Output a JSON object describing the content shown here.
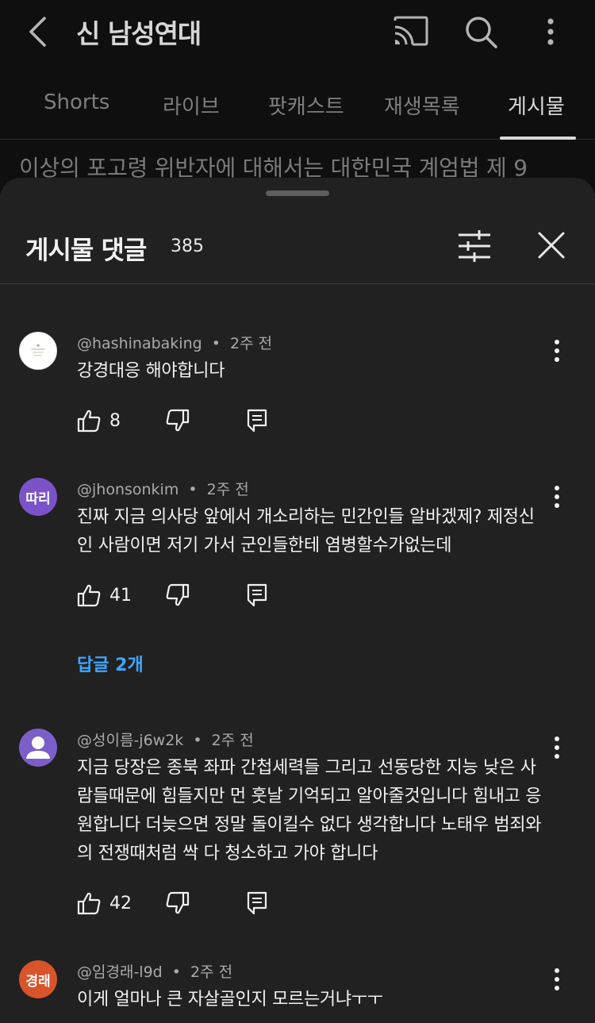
{
  "header": {
    "title": "신 남성연대",
    "icons": [
      "back-icon",
      "cast-icon",
      "search-icon",
      "more-icon"
    ]
  },
  "tabs": [
    {
      "label": "Shorts"
    },
    {
      "label": "라이브"
    },
    {
      "label": "팟캐스트"
    },
    {
      "label": "재생목록"
    },
    {
      "label": "게시물",
      "active": true
    }
  ],
  "post_preview": "이상의 포고령 위반자에 대해서는 대한민국 계엄법 제 9",
  "sheet": {
    "title": "게시물 댓글",
    "count": "385"
  },
  "comments": [
    {
      "author": "@hashinabaking",
      "time": "2주 전",
      "text": "강경대응 해야합니다",
      "likes": "8",
      "avatar_text": "",
      "avatar_color": "#ffffff"
    },
    {
      "author": "@jhonsonkim",
      "time": "2주 전",
      "text": "진짜 지금 의사당 앞에서 개소리하는 민간인들 알바겠제? 제정신인 사람이면 저기 가서 군인들한테 염병할수가없는데",
      "likes": "41",
      "avatar_text": "따리",
      "avatar_color": "#7a53c9",
      "replies": "답글 2개"
    },
    {
      "author": "@성이름-j6w2k",
      "time": "2주 전",
      "text": "지금 당장은 종북 좌파 간첩세력들 그리고 선동당한 지능 낮은 사람들때문에 힘들지만 먼 훗날 기억되고 알아줄것입니다 힘내고 응원합니다 더늦으면 정말 돌이킬수 없다 생각합니다 노태우 범죄와의 전쟁때처럼 싹 다 청소하고 가야 합니다",
      "likes": "42",
      "avatar_text": "",
      "avatar_color": "#7b5fc8"
    },
    {
      "author": "@임경래-l9d",
      "time": "2주 전",
      "text": "이게 얼마나 큰 자살골인지 모르는거냐ㅜㅜ",
      "avatar_text": "경래",
      "avatar_color": "#d9542b"
    }
  ],
  "separator": "•"
}
